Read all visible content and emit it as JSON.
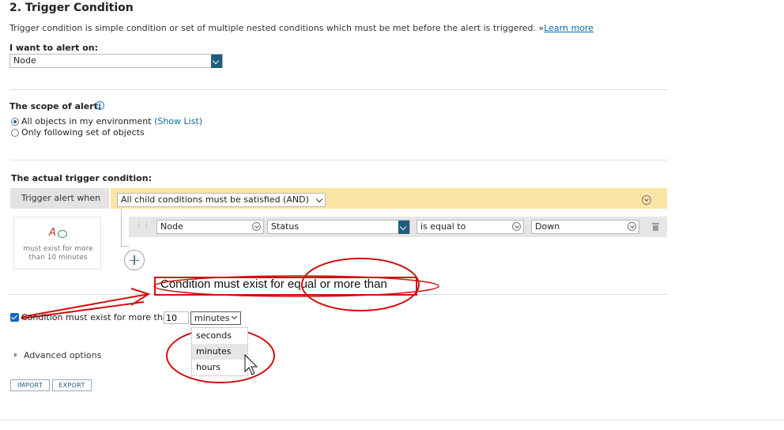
{
  "section": {
    "title": "2. Trigger Condition",
    "description": "Trigger condition is simple condition or set of multiple nested conditions which must be met before the alert is triggered. »",
    "learn_more": "Learn more"
  },
  "alert_on": {
    "label": "I want to alert on:",
    "value": "Node"
  },
  "scope": {
    "label": "The scope of alert:",
    "option_all": "All objects in my environment",
    "show_list": "(Show List)",
    "option_following": "Only following set of objects",
    "selected": "All objects in my environment"
  },
  "trigger": {
    "label": "The actual trigger condition:",
    "trigger_when": "Trigger alert when",
    "group_select": "All child conditions must be satisfied (AND)",
    "row": {
      "object": "Node",
      "field": "Status",
      "operator": "is equal to",
      "value": "Down"
    },
    "sidebar_icon_text": "A",
    "sidebar_text": "must exist for more than 10 minutes"
  },
  "annotation": {
    "text": "Condition must exist for equal or more than"
  },
  "duration": {
    "checkbox_label": "Condition must exist for more than",
    "checked": true,
    "value": "10",
    "unit": "minutes",
    "unit_options": [
      "seconds",
      "minutes",
      "hours"
    ]
  },
  "advanced": {
    "label": "Advanced options"
  },
  "buttons": {
    "import": "IMPORT",
    "export": "EXPORT"
  },
  "colors": {
    "accent": "#1e5d7c",
    "link": "#0a6aa6",
    "group_bar": "#fbe5a6",
    "annotation": "#d11111"
  }
}
